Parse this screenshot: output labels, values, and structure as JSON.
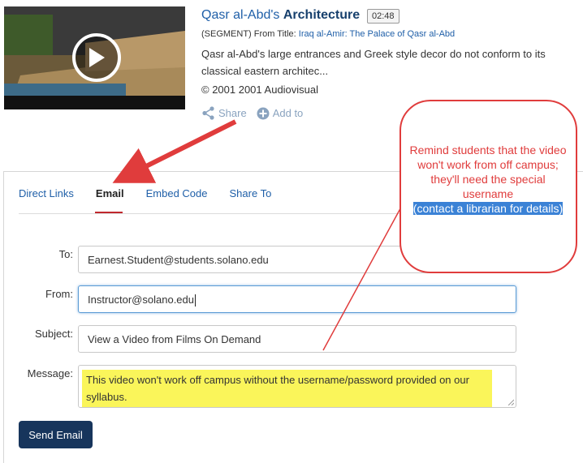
{
  "video": {
    "title_prefix": "Qasr al-Abd's ",
    "title_bold": "Architecture",
    "duration": "02:48",
    "segment_prefix": "(SEGMENT) From Title: ",
    "segment_link": "Iraq al-Amir: The Palace of Qasr al-Abd",
    "description": "Qasr al-Abd's large entrances and Greek style decor do not conform to its classical eastern architec...",
    "copyright": "© 2001 2001 Audiovisual",
    "share_label": "Share",
    "add_to_label": "Add to"
  },
  "tabs": [
    {
      "label": "Direct Links",
      "active": false
    },
    {
      "label": "Email",
      "active": true
    },
    {
      "label": "Embed Code",
      "active": false
    },
    {
      "label": "Share To",
      "active": false
    }
  ],
  "form": {
    "to_label": "To:",
    "to_value": "Earnest.Student@students.solano.edu",
    "from_label": "From:",
    "from_value": "Instructor@solano.edu",
    "subject_label": "Subject:",
    "subject_value": "View a Video from Films On Demand",
    "message_label": "Message:",
    "message_value": "This video won't work off campus without the username/password provided on our syllabus.",
    "send_label": "Send Email"
  },
  "callout": {
    "text_normal": "Remind students that the video won't work from off campus; they'll need the special username",
    "text_selected": "(contact a librarian for details)"
  },
  "colors": {
    "link": "#1f5fa8",
    "active_tab_underline": "#c0282d",
    "button_bg": "#17355c",
    "highlight": "#faf55a",
    "annotation_red": "#e03c3c",
    "selection_blue": "#3b82d6"
  },
  "icons": {
    "play": "play-icon",
    "share": "share-icon",
    "add": "plus-circle-icon"
  }
}
